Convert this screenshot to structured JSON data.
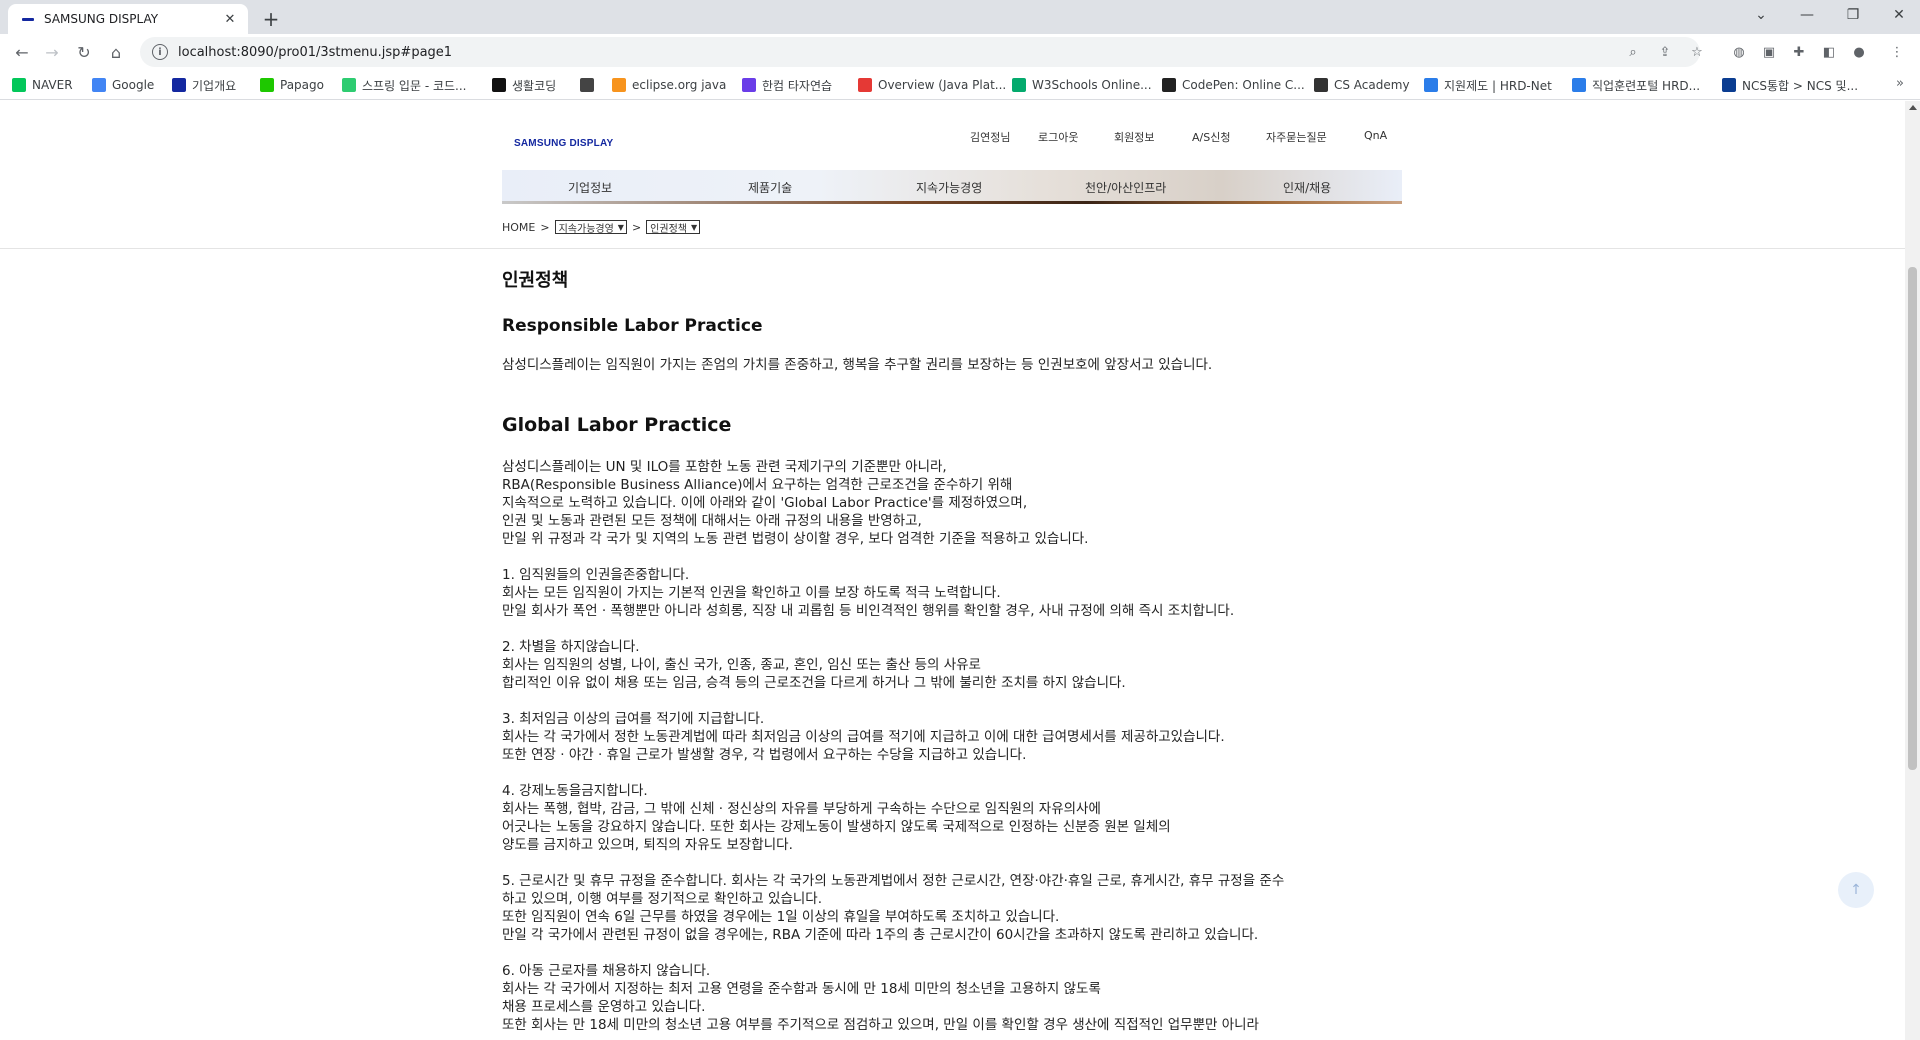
{
  "browser": {
    "tab_title": "SAMSUNG DISPLAY",
    "tab_close": "✕",
    "new_tab": "+",
    "url": "localhost:8090/pro01/3stmenu.jsp#page1",
    "bookmarks": [
      {
        "label": "NAVER",
        "color": "#03c75a"
      },
      {
        "label": "Google",
        "color": "#4285f4"
      },
      {
        "label": "기업개요",
        "color": "#1428a0"
      },
      {
        "label": "Papago",
        "color": "#1ec800"
      },
      {
        "label": "스프링 입문 - 코드...",
        "color": "#2ecc71"
      },
      {
        "label": "생활코딩",
        "color": "#111111"
      },
      {
        "label": "",
        "color": "#444444"
      },
      {
        "label": "eclipse.org java",
        "color": "#f7941e"
      },
      {
        "label": "한컴 타자연습",
        "color": "#6a3de8"
      },
      {
        "label": "Overview (Java Plat...",
        "color": "#e53935"
      },
      {
        "label": "W3Schools Online...",
        "color": "#04aa6d"
      },
      {
        "label": "CodePen: Online C...",
        "color": "#222222"
      },
      {
        "label": "CS Academy",
        "color": "#333333"
      },
      {
        "label": "지원제도 | HRD-Net",
        "color": "#2b7de9"
      },
      {
        "label": "직업훈련포털 HRD...",
        "color": "#2b7de9"
      },
      {
        "label": "NCS통합 > NCS 및...",
        "color": "#0b3d91"
      }
    ],
    "bookmarks_more": "»"
  },
  "header": {
    "logo": "SAMSUNG DISPLAY",
    "user_name": "김연정님",
    "links": [
      "로그아웃",
      "회원정보",
      "A/S신청",
      "자주묻는질문",
      "QnA"
    ],
    "nav": [
      "기업정보",
      "제품기술",
      "지속가능경영",
      "천안/아산인프라",
      "인재/채용"
    ],
    "breadcrumb": {
      "home": "HOME",
      "sep": ">",
      "select1": "지속가능경영",
      "select2": "인권정책"
    }
  },
  "content": {
    "page_title": "인권정책",
    "section1_title": "Responsible Labor Practice",
    "section1_text": "삼성디스플레이는 임직원이 가지는 존엄의 가치를 존중하고, 행복을 추구할 권리를 보장하는 등 인권보호에 앞장서고 있습니다.",
    "section2_title": "Global Labor Practice",
    "lines": [
      "삼성디스플레이는 UN 및 ILO를 포함한 노동 관련 국제기구의 기준뿐만 아니라,",
      "RBA(Responsible Business Alliance)에서 요구하는 엄격한 근로조건을 준수하기 위해",
      "지속적으로 노력하고 있습니다. 이에 아래와 같이 'Global Labor Practice'를 제정하였으며,",
      "인권 및 노동과 관련된 모든 정책에 대해서는 아래 규정의 내용을 반영하고,",
      "만일 위 규정과 각 국가 및 지역의 노동 관련 법령이 상이할 경우, 보다 엄격한 기준을 적용하고 있습니다.",
      "",
      "1. 임직원들의 인권을존중합니다.",
      "회사는 모든 임직원이 가지는 기본적 인권을 확인하고 이를 보장 하도록 적극 노력합니다.",
      "만일 회사가 폭언 · 폭행뿐만 아니라 성희롱, 직장 내 괴롭힘 등 비인격적인 행위를 확인할 경우, 사내 규정에 의해 즉시 조치합니다.",
      "",
      "2. 차별을 하지않습니다.",
      "회사는 임직원의 성별, 나이, 출신 국가, 인종, 종교, 혼인, 임신 또는 출산 등의 사유로",
      "합리적인 이유 없이 채용 또는 임금, 승격 등의 근로조건을 다르게 하거나 그 밖에 불리한 조치를 하지 않습니다.",
      "",
      "3. 최저임금 이상의 급여를 적기에 지급합니다.",
      "회사는 각 국가에서 정한 노동관계법에 따라 최저임금 이상의 급여를 적기에 지급하고 이에 대한 급여명세서를 제공하고있습니다.",
      "또한 연장 · 야간 · 휴일 근로가 발생할 경우, 각 법령에서 요구하는 수당을 지급하고 있습니다.",
      "",
      "4. 강제노동을금지합니다.",
      "회사는 폭행, 협박, 감금, 그 밖에 신체 · 정신상의 자유를 부당하게 구속하는 수단으로 임직원의 자유의사에",
      "어긋나는 노동을 강요하지 않습니다. 또한 회사는 강제노동이 발생하지 않도록 국제적으로 인정하는 신분증 원본 일체의",
      "양도를 금지하고 있으며, 퇴직의 자유도 보장합니다.",
      "",
      "5. 근로시간 및 휴무 규정을 준수합니다. 회사는 각 국가의 노동관계법에서 정한 근로시간, 연장·야간·휴일 근로, 휴게시간, 휴무 규정을 준수",
      "하고 있으며, 이행 여부를 정기적으로 확인하고 있습니다.",
      "또한 임직원이 연속 6일 근무를 하였을 경우에는 1일 이상의 휴일을 부여하도록 조치하고 있습니다.",
      "만일 각 국가에서 관련된 규정이 없을 경우에는, RBA 기준에 따라 1주의 총 근로시간이 60시간을 초과하지 않도록 관리하고 있습니다.",
      "",
      "6. 아동 근로자를 채용하지 않습니다.",
      "회사는 각 국가에서 지정하는 최저 고용 연령을 준수함과 동시에 만 18세 미만의 청소년을 고용하지 않도록",
      "채용 프로세스를 운영하고 있습니다.",
      "또한 회사는 만 18세 미만의 청소년 고용 여부를 주기적으로 점검하고 있으며, 만일 이를 확인할 경우 생산에 직접적인 업무뿐만 아니라"
    ]
  }
}
